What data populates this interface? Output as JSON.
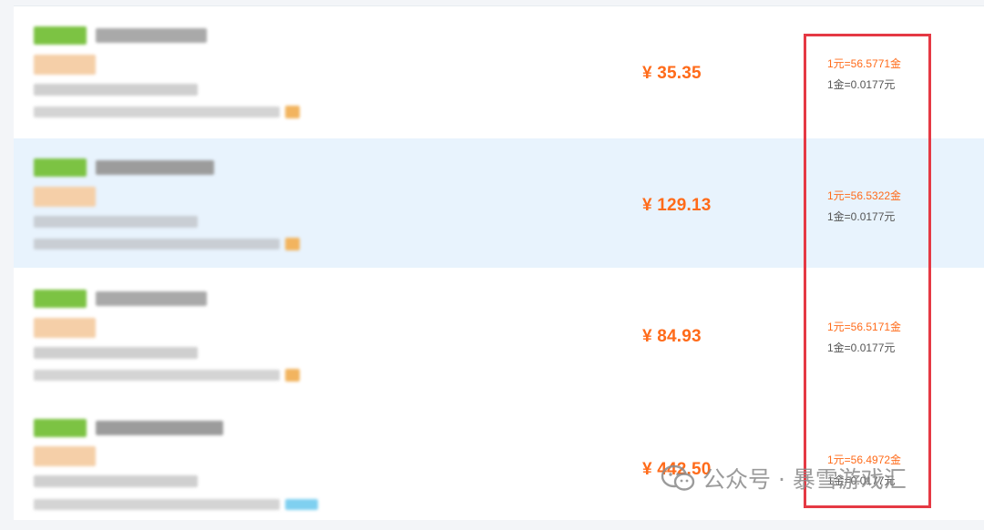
{
  "listings": [
    {
      "price": "¥ 35.35",
      "rate_gold_per_yuan": "1元=56.5771金",
      "rate_yuan_per_gold": "1金=0.0177元",
      "highlighted": false,
      "hot": false
    },
    {
      "price": "¥ 129.13",
      "rate_gold_per_yuan": "1元=56.5322金",
      "rate_yuan_per_gold": "1金=0.0177元",
      "highlighted": true,
      "hot": true
    },
    {
      "price": "¥ 84.93",
      "rate_gold_per_yuan": "1元=56.5171金",
      "rate_yuan_per_gold": "1金=0.0177元",
      "highlighted": false,
      "hot": false
    },
    {
      "price": "¥ 442.50",
      "rate_gold_per_yuan": "1元=56.4972金",
      "rate_yuan_per_gold": "1金=0.0177元",
      "highlighted": false,
      "hot": false
    }
  ],
  "watermark": {
    "text": "公众号 · 暴雪游戏汇",
    "icon": "wechat-icon"
  },
  "colors": {
    "price": "#ff6b1a",
    "highlight_row": "#e8f3fd",
    "annotation_box": "#e53944",
    "green_tag": "#7cc343"
  }
}
